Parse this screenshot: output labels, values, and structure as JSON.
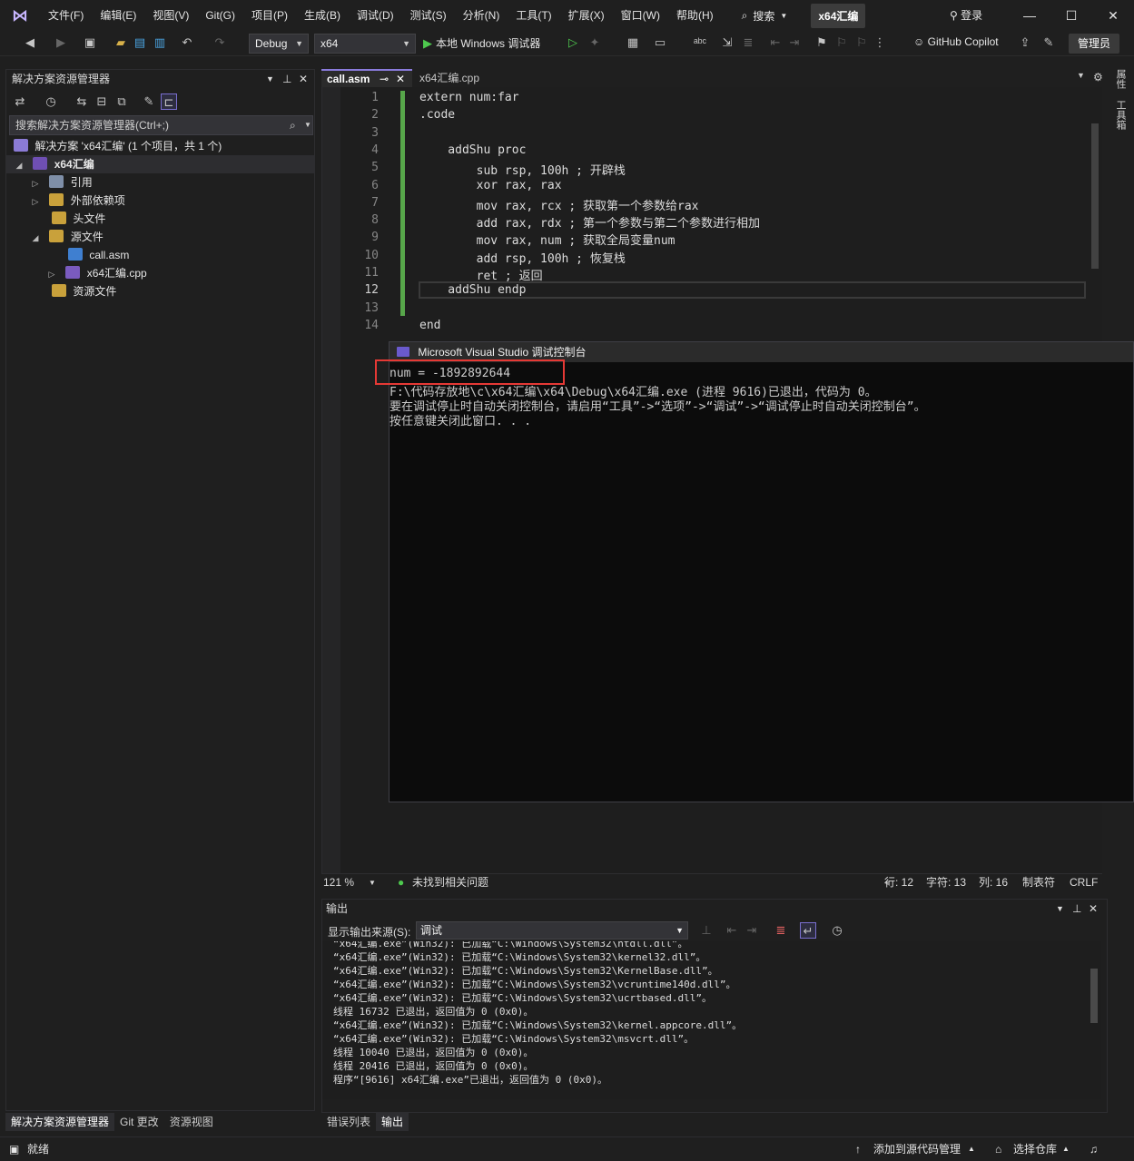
{
  "menubar": {
    "items": [
      "文件(F)",
      "编辑(E)",
      "视图(V)",
      "Git(G)",
      "项目(P)",
      "生成(B)",
      "调试(D)",
      "测试(S)",
      "分析(N)",
      "工具(T)",
      "扩展(X)",
      "窗口(W)",
      "帮助(H)"
    ],
    "search_label": "搜索",
    "solution_name": "x64汇编",
    "login_label": "登录"
  },
  "toolbar": {
    "config": "Debug",
    "platform": "x64",
    "run_label": "本地 Windows 调试器",
    "copilot_label": "GitHub Copilot",
    "admin_label": "管理员"
  },
  "solution_explorer": {
    "title": "解决方案资源管理器",
    "search_placeholder": "搜索解决方案资源管理器(Ctrl+;)",
    "tree": {
      "solution": "解决方案 'x64汇编' (1 个项目，共 1 个)",
      "project": "x64汇编",
      "references": "引用",
      "external": "外部依赖项",
      "headers": "头文件",
      "sources": "源文件",
      "file_asm": "call.asm",
      "file_cpp": "x64汇编.cpp",
      "resources": "资源文件"
    },
    "bottom_tabs": [
      "解决方案资源管理器",
      "Git 更改",
      "资源视图"
    ]
  },
  "editor": {
    "tabs": {
      "active": "call.asm",
      "other": "x64汇编.cpp"
    },
    "lines": [
      {
        "n": "1",
        "text": "extern num:far"
      },
      {
        "n": "2",
        "text": ".code"
      },
      {
        "n": "3",
        "text": ""
      },
      {
        "n": "4",
        "text": "    addShu proc"
      },
      {
        "n": "5",
        "text": "        sub rsp, 100h ; 开辟栈"
      },
      {
        "n": "6",
        "text": "        xor rax, rax"
      },
      {
        "n": "7",
        "text": "        mov rax, rcx ; 获取第一个参数给rax"
      },
      {
        "n": "8",
        "text": "        add rax, rdx ; 第一个参数与第二个参数进行相加"
      },
      {
        "n": "9",
        "text": "        mov rax, num ; 获取全局变量num"
      },
      {
        "n": "10",
        "text": "        add rsp, 100h ; 恢复栈"
      },
      {
        "n": "11",
        "text": "        ret ; 返回"
      },
      {
        "n": "12",
        "text": "    addShu endp"
      },
      {
        "n": "13",
        "text": ""
      },
      {
        "n": "14",
        "text": "end"
      }
    ],
    "status": {
      "zoom": "121 %",
      "issues": "未找到相关问题",
      "line": "行: 12",
      "char": "字符: 13",
      "col": "列: 16",
      "indent": "制表符",
      "eol": "CRLF"
    }
  },
  "right_strip": {
    "tab1": "属性",
    "tab2": "工具箱"
  },
  "console": {
    "title": "Microsoft Visual Studio 调试控制台",
    "lines": [
      "num = -1892892644",
      "F:\\代码存放地\\c\\x64汇编\\x64\\Debug\\x64汇编.exe (进程 9616)已退出，代码为 0。",
      "要在调试停止时自动关闭控制台，请启用“工具”->“选项”->“调试”->“调试停止时自动关闭控制台”。",
      "按任意键关闭此窗口. . ."
    ]
  },
  "output": {
    "title": "输出",
    "source_label": "显示输出来源(S):",
    "source_value": "调试",
    "lines": [
      "“x64汇编.exe”(Win32): 已加载“C:\\Windows\\System32\\ntdll.dll”。",
      "“x64汇编.exe”(Win32): 已加载“C:\\Windows\\System32\\kernel32.dll”。",
      "“x64汇编.exe”(Win32): 已加载“C:\\Windows\\System32\\KernelBase.dll”。",
      "“x64汇编.exe”(Win32): 已加载“C:\\Windows\\System32\\vcruntime140d.dll”。",
      "“x64汇编.exe”(Win32): 已加载“C:\\Windows\\System32\\ucrtbased.dll”。",
      "线程 16732 已退出，返回值为 0 (0x0)。",
      "“x64汇编.exe”(Win32): 已加载“C:\\Windows\\System32\\kernel.appcore.dll”。",
      "“x64汇编.exe”(Win32): 已加载“C:\\Windows\\System32\\msvcrt.dll”。",
      "线程 10040 已退出，返回值为 0 (0x0)。",
      "线程 20416 已退出，返回值为 0 (0x0)。",
      "程序“[9616] x64汇编.exe”已退出，返回值为 0 (0x0)。"
    ],
    "bottom_tabs": [
      "错误列表",
      "输出"
    ]
  },
  "statusbar": {
    "ready": "就绪",
    "add_source": "添加到源代码管理",
    "select_repo": "选择仓库"
  }
}
